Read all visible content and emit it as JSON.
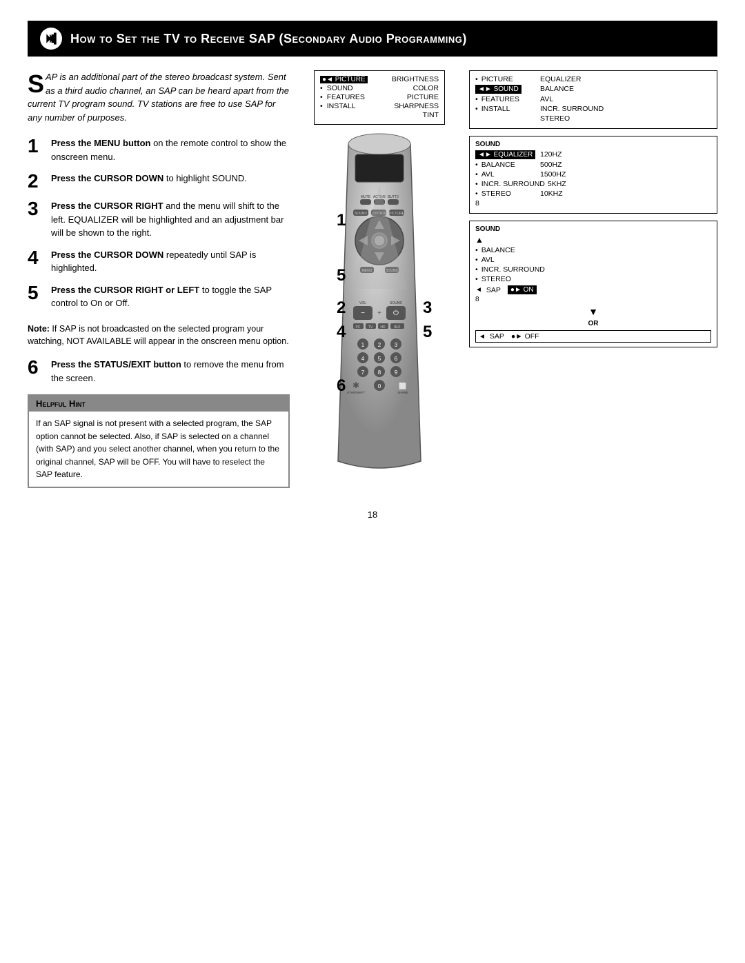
{
  "header": {
    "title": "How to Set the TV to Receive SAP (Secondary Audio Programming)"
  },
  "intro": {
    "drop_cap": "S",
    "text": "AP is an additional part of the stereo broadcast system.  Sent as a third audio channel, an SAP can be heard apart from the current TV program sound.  TV stations are free to use SAP for any number of purposes."
  },
  "steps": [
    {
      "number": "1",
      "text_bold": "Press the MENU button",
      "text": " on the remote control to show the onscreen menu."
    },
    {
      "number": "2",
      "text_bold": "Press the CURSOR DOWN",
      "text": " to highlight SOUND."
    },
    {
      "number": "3",
      "text_bold": "Press the CURSOR RIGHT",
      "text": " and the menu will shift to the left. EQUALIZER will be highlighted and an adjustment bar will be shown to the right."
    },
    {
      "number": "4",
      "text_bold": "Press the CURSOR DOWN",
      "text": " repeatedly until SAP is highlighted."
    },
    {
      "number": "5",
      "text_bold": "Press the CURSOR RIGHT or LEFT",
      "text": " to toggle the SAP control to On or Off."
    }
  ],
  "note": {
    "label": "Note:",
    "text": " If SAP is not broadcasted on the selected program your watching, NOT AVAILABLE will appear in the onscreen menu option."
  },
  "step6": {
    "number": "6",
    "text_bold": "Press the STATUS/EXIT button",
    "text": " to remove the menu from the screen."
  },
  "hint": {
    "title": "Helpful Hint",
    "body": "If an SAP signal is not present with a selected program, the SAP option cannot be selected.  Also, if SAP is selected on a channel (with SAP) and you select another channel, when you return to the original channel, SAP will be OFF.  You will have to reselect the SAP feature."
  },
  "menu1": {
    "items": [
      {
        "label": "PICTURE",
        "value": "BRIGHTNESS",
        "highlighted": true
      },
      {
        "label": "SOUND",
        "value": "COLOR",
        "highlighted": false
      },
      {
        "label": "FEATURES",
        "value": "PICTURE",
        "highlighted": false
      },
      {
        "label": "INSTALL",
        "value": "SHARPNESS",
        "highlighted": false
      },
      {
        "label": "",
        "value": "TINT",
        "highlighted": false
      }
    ]
  },
  "menu2": {
    "items": [
      {
        "label": "PICTURE",
        "value": "EQUALIZER",
        "highlighted": false
      },
      {
        "label": "SOUND",
        "value": "BALANCE",
        "highlighted": true
      },
      {
        "label": "FEATURES",
        "value": "AVL",
        "highlighted": false
      },
      {
        "label": "INSTALL",
        "value": "INCR. SURROUND",
        "highlighted": false
      },
      {
        "label": "",
        "value": "STEREO",
        "highlighted": false
      }
    ]
  },
  "menu3": {
    "title": "SOUND",
    "items": [
      {
        "label": "EQUALIZER",
        "value": "120HZ",
        "highlighted": true
      },
      {
        "label": "BALANCE",
        "value": "500HZ",
        "highlighted": false
      },
      {
        "label": "AVL",
        "value": "1500HZ",
        "highlighted": false
      },
      {
        "label": "INCR. SURROUND",
        "value": "5KHZ",
        "highlighted": false
      },
      {
        "label": "STEREO",
        "value": "10KHZ",
        "highlighted": false
      },
      {
        "label": "8",
        "value": "",
        "highlighted": false
      }
    ]
  },
  "menu4": {
    "title": "SOUND",
    "items": [
      {
        "label": "BALANCE",
        "value": "",
        "highlighted": false
      },
      {
        "label": "AVL",
        "value": "",
        "highlighted": false
      },
      {
        "label": "INCR. SURROUND",
        "value": "",
        "highlighted": false
      },
      {
        "label": "STEREO",
        "value": "",
        "highlighted": false
      },
      {
        "label": "SAP",
        "value": "ON",
        "highlighted": true
      },
      {
        "label": "8",
        "value": "",
        "highlighted": false
      }
    ],
    "sap_on_arrow": "◄",
    "sap_on_label": "SAP",
    "sap_on_value": "●► ON",
    "or_text": "OR",
    "sap_off_arrow": "◄",
    "sap_off_label": "SAP",
    "sap_off_value": "●► OFF"
  },
  "step_numbers_on_remote": [
    "1",
    "5",
    "2",
    "4",
    "3",
    "5",
    "6"
  ],
  "page_number": "18"
}
